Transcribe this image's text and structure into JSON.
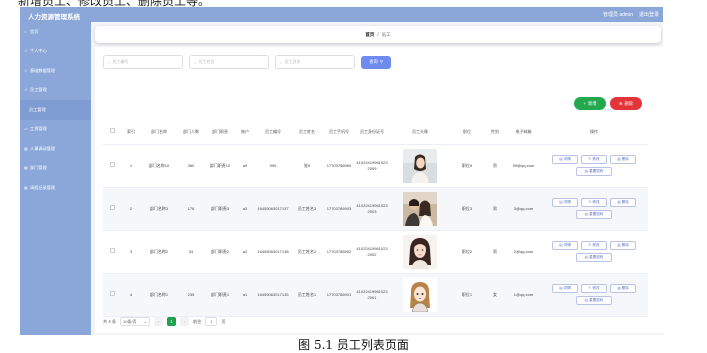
{
  "top_fragment": "新增员工、修改员工、删除员工等。",
  "header": {
    "title": "人力资源管理系统",
    "user": "管理员 admin",
    "logout": "退出登录"
  },
  "sidebar": {
    "items": [
      {
        "label": "首页",
        "icon": "home-icon"
      },
      {
        "label": "个人中心",
        "icon": "user-icon"
      },
      {
        "label": "基础数据管理",
        "icon": "user-icon"
      },
      {
        "label": "员工管理",
        "icon": "user-icon"
      },
      {
        "label": "员工管理",
        "icon": ""
      },
      {
        "label": "工资管理",
        "icon": "document-icon"
      },
      {
        "label": "人事调动管理",
        "icon": "grid-icon"
      },
      {
        "label": "部门管理",
        "icon": "grid-icon"
      },
      {
        "label": "请假记录管理",
        "icon": "grid-icon"
      }
    ]
  },
  "breadcrumb": {
    "home": "首页",
    "separator": "/",
    "current": "员工"
  },
  "search": {
    "placeholder_no": "员工编号",
    "placeholder_name": "员工姓名",
    "placeholder_idcard": "员工身份",
    "button": "查询"
  },
  "actions": {
    "add": "新增",
    "delete": "删除"
  },
  "table": {
    "headers": [
      "",
      "索引",
      "部门名称",
      "部门人数",
      "部门职责",
      "账户",
      "员工编号",
      "员工姓名",
      "员工手机号",
      "员工身份证号",
      "员工头像",
      "职位",
      "性别",
      "电子邮箱",
      "操作"
    ],
    "rows": [
      {
        "index": "1",
        "dept": "部门名称10",
        "count": "360",
        "duty": "部门职责10",
        "account": "a9",
        "no": "999",
        "name": "张9",
        "phone": "17703786969",
        "idcard": "410224199610232009",
        "position": "职位9",
        "gender": "男",
        "email": "99@qq.com",
        "avatar": "avatar-girl-profile"
      },
      {
        "index": "2",
        "dept": "部门名称3",
        "count": "176",
        "duty": "部门职责3",
        "account": "a3",
        "no": "16455063017137",
        "name": "员工姓名3",
        "phone": "17703786903",
        "idcard": "410224199610232003",
        "position": "职位3",
        "gender": "男",
        "email": "3@qq.com",
        "avatar": "avatar-couple-photo"
      },
      {
        "index": "3",
        "dept": "部门名称2",
        "count": "34",
        "duty": "部门职责2",
        "account": "a2",
        "no": "16455063017138",
        "name": "员工姓名2",
        "phone": "17703786902",
        "idcard": "410224199610232002",
        "position": "职位2",
        "gender": "男",
        "email": "2@qq.com",
        "avatar": "avatar-woman-portrait"
      },
      {
        "index": "4",
        "dept": "部门名称1",
        "count": "235",
        "duty": "部门职责1",
        "account": "a1",
        "no": "16455063017135",
        "name": "员工姓名1",
        "phone": "17703786901",
        "idcard": "410224199610232001",
        "position": "职位1",
        "gender": "女",
        "email": "1@qq.com",
        "avatar": "avatar-cartoon-girl"
      }
    ],
    "ops": {
      "detail": "详情",
      "edit": "修改",
      "delete": "删除",
      "reset": "重置密码"
    }
  },
  "pagination": {
    "total": "共 4 条",
    "page_size": "10条/页",
    "current": "1",
    "goto": "前往",
    "page_value": "1",
    "page_unit": "页"
  },
  "caption": "图 5.1   员工列表页面",
  "colors": {
    "sidebar": "#8ba7d9",
    "add": "#23a84d",
    "delete": "#e3343a",
    "search": "#6e8bf0",
    "pager_active": "#1ea14a"
  }
}
